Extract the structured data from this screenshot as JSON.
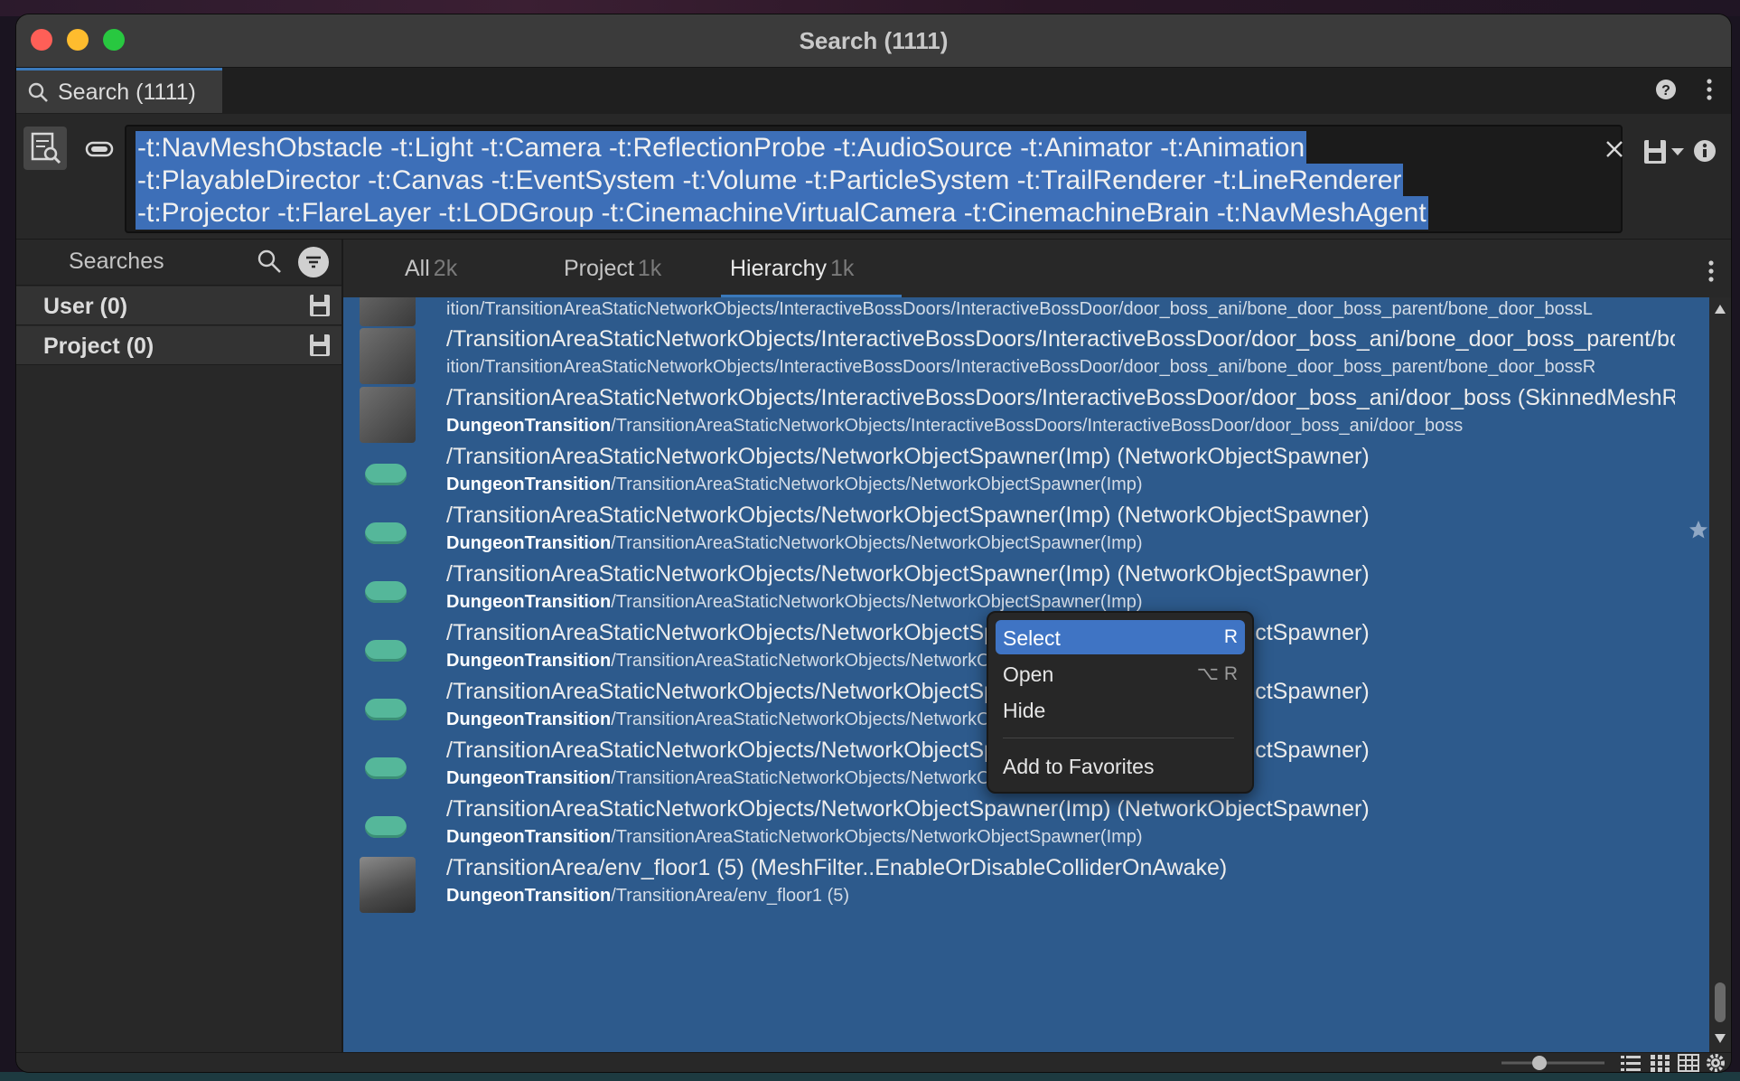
{
  "window": {
    "title": "Search (1111)"
  },
  "tab": {
    "label": "Search (1111)"
  },
  "query": {
    "lines": [
      "-t:NavMeshObstacle -t:Light -t:Camera -t:ReflectionProbe -t:AudioSource -t:Animator -t:Animation",
      "-t:PlayableDirector -t:Canvas -t:EventSystem -t:Volume -t:ParticleSystem -t:TrailRenderer -t:LineRenderer",
      "-t:Projector -t:FlareLayer -t:LODGroup -t:CinemachineVirtualCamera -t:CinemachineBrain -t:NavMeshAgent"
    ]
  },
  "sidebar": {
    "title": "Searches",
    "saved": [
      {
        "label": "User (0)"
      },
      {
        "label": "Project (0)"
      }
    ]
  },
  "results_tabs": [
    {
      "label": "All",
      "count": "2k"
    },
    {
      "label": "Project",
      "count": "1k"
    },
    {
      "label": "Hierarchy",
      "count": "1k"
    }
  ],
  "rows": [
    {
      "label": "",
      "desc_bold": "",
      "desc": "ition/TransitionAreaStaticNetworkObjects/InteractiveBossDoors/InteractiveBossDoor/door_boss_ani/bone_door_boss_parent/bone_door_bossL"
    },
    {
      "label": "/TransitionAreaStaticNetworkObjects/InteractiveBossDoors/InteractiveBossDoor/door_boss_ani/bone_door_boss_parent/bone",
      "desc_bold": "",
      "desc": "ition/TransitionAreaStaticNetworkObjects/InteractiveBossDoors/InteractiveBossDoor/door_boss_ani/bone_door_boss_parent/bone_door_bossR"
    },
    {
      "label": "/TransitionAreaStaticNetworkObjects/InteractiveBossDoors/InteractiveBossDoor/door_boss_ani/door_boss (SkinnedMeshRen",
      "desc_bold": "DungeonTransition",
      "desc": "/TransitionAreaStaticNetworkObjects/InteractiveBossDoors/InteractiveBossDoor/door_boss_ani/door_boss"
    },
    {
      "label": "/TransitionAreaStaticNetworkObjects/NetworkObjectSpawner(Imp) (NetworkObjectSpawner)",
      "desc_bold": "DungeonTransition",
      "desc": "/TransitionAreaStaticNetworkObjects/NetworkObjectSpawner(Imp)"
    },
    {
      "label": "/TransitionAreaStaticNetworkObjects/NetworkObjectSpawner(Imp) (NetworkObjectSpawner)",
      "desc_bold": "DungeonTransition",
      "desc": "/TransitionAreaStaticNetworkObjects/NetworkObjectSpawner(Imp)"
    },
    {
      "label": "/TransitionAreaStaticNetworkObjects/NetworkObjectSpawner(Imp) (NetworkObjectSpawner)",
      "desc_bold": "DungeonTransition",
      "desc": "/TransitionAreaStaticNetworkObjects/NetworkObjectSpawner(Imp)"
    },
    {
      "label": "/TransitionAreaStaticNetworkObjects/NetworkObjectSpawner(Imp) (NetworkObjectSpawner)",
      "desc_bold": "DungeonTransition",
      "desc": "/TransitionAreaStaticNetworkObjects/NetworkObjectSpawner(Imp)"
    },
    {
      "label": "/TransitionAreaStaticNetworkObjects/NetworkObjectSpawner(Imp) (NetworkObjectSpawner)",
      "desc_bold": "DungeonTransition",
      "desc": "/TransitionAreaStaticNetworkObjects/NetworkObjectSpawner(Imp)"
    },
    {
      "label": "/TransitionAreaStaticNetworkObjects/NetworkObjectSpawner(Imp) (NetworkObjectSpawner)",
      "desc_bold": "DungeonTransition",
      "desc": "/TransitionAreaStaticNetworkObjects/NetworkObjectSpawner(Imp)"
    },
    {
      "label": "/TransitionAreaStaticNetworkObjects/NetworkObjectSpawner(Imp) (NetworkObjectSpawner)",
      "desc_bold": "DungeonTransition",
      "desc": "/TransitionAreaStaticNetworkObjects/NetworkObjectSpawner(Imp)"
    },
    {
      "label": "/TransitionArea/env_floor1 (5) (MeshFilter..EnableOrDisableColliderOnAwake)",
      "desc_bold": "DungeonTransition",
      "desc": "/TransitionArea/env_floor1 (5)"
    }
  ],
  "context_menu": {
    "items": [
      {
        "label": "Select",
        "shortcut": "R"
      },
      {
        "label": "Open",
        "shortcut": "⌥ R"
      },
      {
        "label": "Hide",
        "shortcut": ""
      },
      {
        "label": "Add to Favorites",
        "shortcut": ""
      }
    ]
  },
  "colors": {
    "selection": "#2d5a8c",
    "accent": "#3a79bb",
    "menu_highlight": "#3f74c4",
    "spawner_pill": "#55b79a"
  }
}
